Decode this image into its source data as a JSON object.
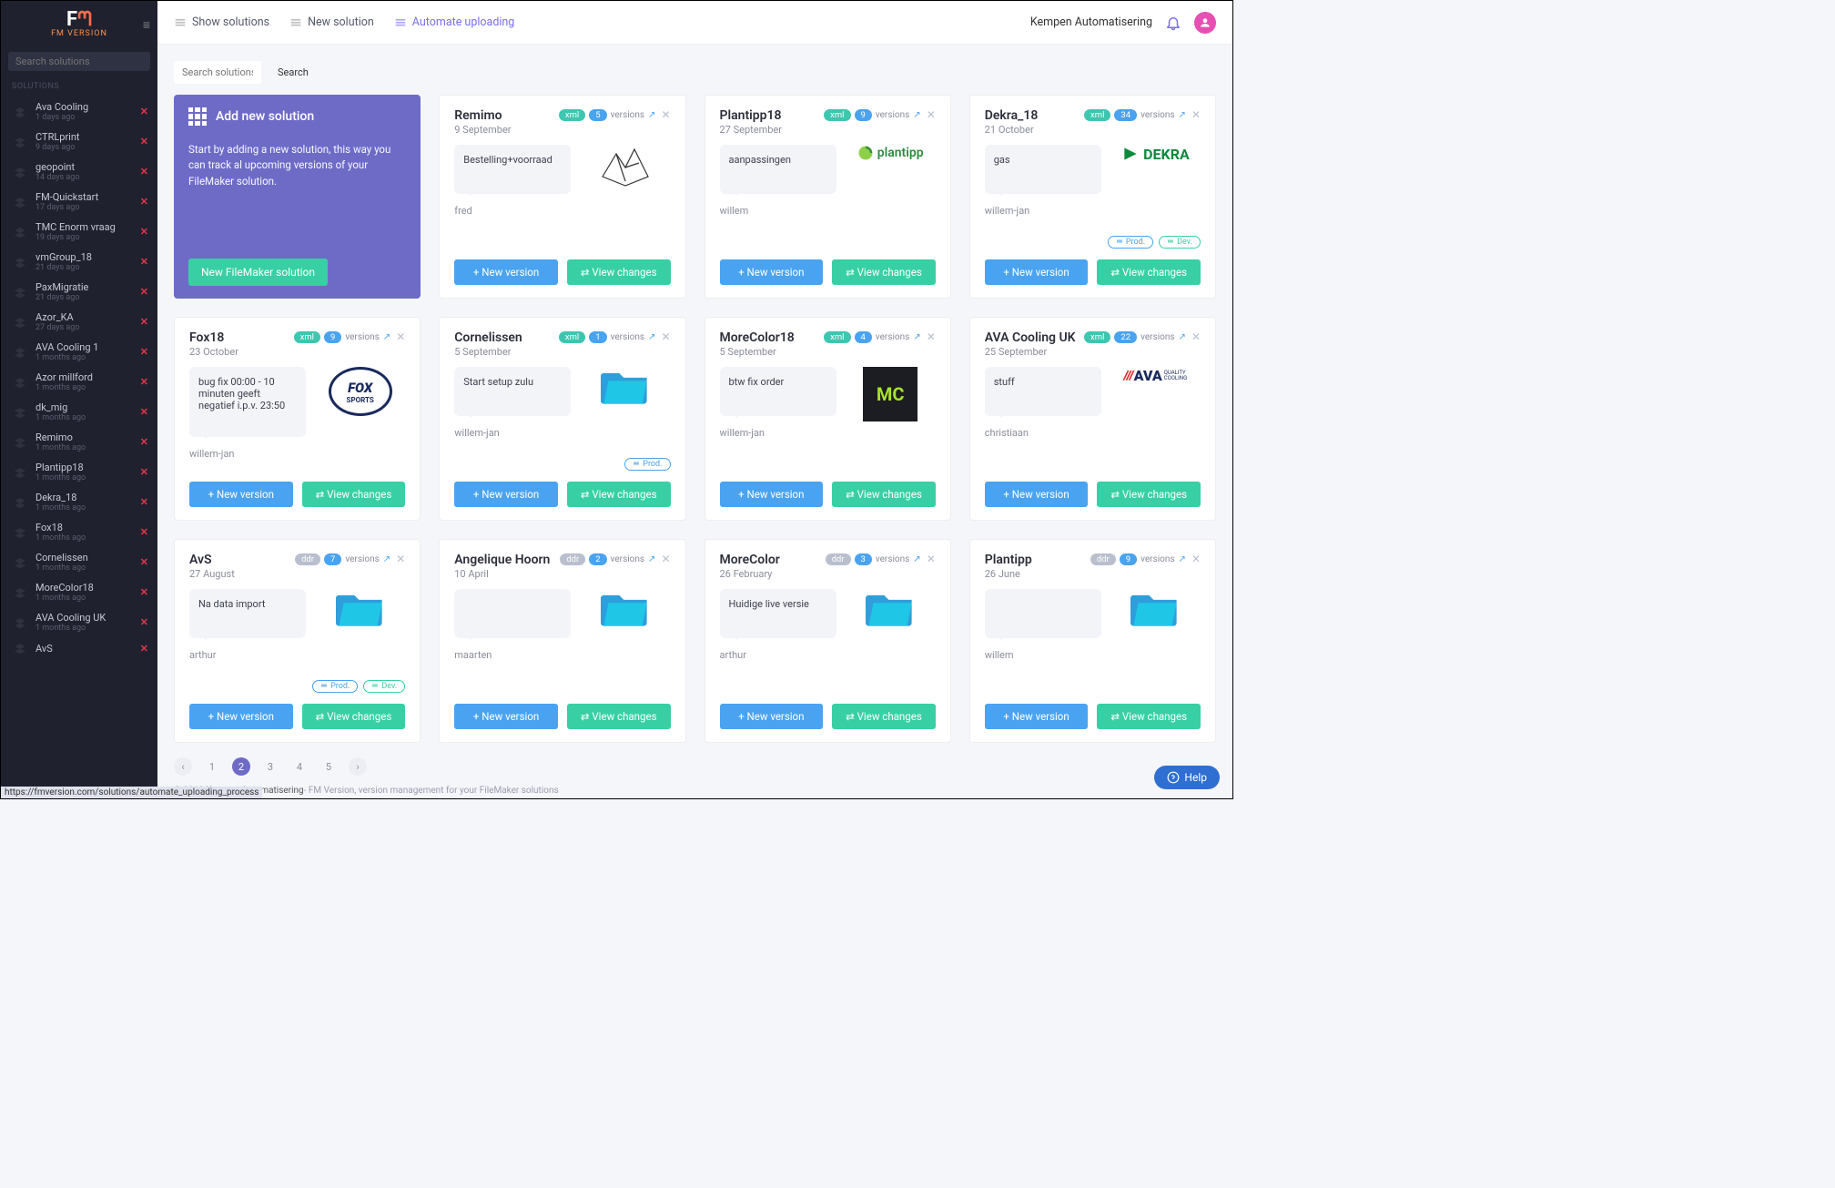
{
  "brand": {
    "name": "FM VERSION"
  },
  "sidebar": {
    "search_placeholder": "Search solutions",
    "section": "SOLUTIONS",
    "items": [
      {
        "name": "Ava Cooling",
        "age": "1 days ago"
      },
      {
        "name": "CTRLprint",
        "age": "9 days ago"
      },
      {
        "name": "geopoint",
        "age": "14 days ago"
      },
      {
        "name": "FM-Quickstart",
        "age": "17 days ago"
      },
      {
        "name": "TMC Enorm vraag",
        "age": "19 days ago"
      },
      {
        "name": "vmGroup_18",
        "age": "21 days ago"
      },
      {
        "name": "PaxMigratie",
        "age": "21 days ago"
      },
      {
        "name": "Azor_KA",
        "age": "27 days ago"
      },
      {
        "name": "AVA Cooling 1",
        "age": "1 months ago"
      },
      {
        "name": "Azor millford",
        "age": "1 months ago"
      },
      {
        "name": "dk_mig",
        "age": "1 months ago"
      },
      {
        "name": "Remimo",
        "age": "1 months ago"
      },
      {
        "name": "Plantipp18",
        "age": "1 months ago"
      },
      {
        "name": "Dekra_18",
        "age": "1 months ago"
      },
      {
        "name": "Fox18",
        "age": "1 months ago"
      },
      {
        "name": "Cornelissen",
        "age": "1 months ago"
      },
      {
        "name": "MoreColor18",
        "age": "1 months ago"
      },
      {
        "name": "AVA Cooling UK",
        "age": "1 months ago"
      },
      {
        "name": "AvS",
        "age": ""
      }
    ]
  },
  "topbar": {
    "links": {
      "show": "Show solutions",
      "new": "New solution",
      "auto": "Automate uploading"
    },
    "org": "Kempen Automatisering"
  },
  "search": {
    "placeholder": "Search solutions",
    "button": "Search"
  },
  "hero": {
    "title": "Add new solution",
    "desc": "Start by adding a new solution, this way you can track al upcoming versions of your FileMaker solution.",
    "button": "New FileMaker solution"
  },
  "labels": {
    "versions": "versions",
    "new_version": "New version",
    "view_changes": "View changes",
    "prod": "Prod.",
    "dev": "Dev.",
    "help": "Help"
  },
  "cards": [
    {
      "title": "Remimo",
      "date": "9 September",
      "type": "xml",
      "count": "5",
      "note": "Bestelling+voorraad",
      "author": "fred",
      "logo": "origami",
      "tags": []
    },
    {
      "title": "Plantipp18",
      "date": "27 September",
      "type": "xml",
      "count": "9",
      "note": "aanpassingen",
      "author": "willem",
      "logo": "plantipp",
      "tags": []
    },
    {
      "title": "Dekra_18",
      "date": "21 October",
      "type": "xml",
      "count": "34",
      "note": "gas",
      "author": "willem-jan",
      "logo": "dekra",
      "tags": [
        "prod",
        "dev"
      ]
    },
    {
      "title": "Fox18",
      "date": "23 October",
      "type": "xml",
      "count": "9",
      "note": "bug fix 00:00 - 10 minuten geeft negatief i.p.v. 23:50",
      "author": "willem-jan",
      "logo": "fox",
      "tags": []
    },
    {
      "title": "Cornelissen",
      "date": "5 September",
      "type": "xml",
      "count": "1",
      "note": "Start setup zulu",
      "author": "willem-jan",
      "logo": "folder",
      "tags": [
        "prod"
      ]
    },
    {
      "title": "MoreColor18",
      "date": "5 September",
      "type": "xml",
      "count": "4",
      "note": "btw fix order",
      "author": "willem-jan",
      "logo": "mc",
      "tags": []
    },
    {
      "title": "AVA Cooling UK",
      "date": "25 September",
      "type": "xml",
      "count": "22",
      "note": "stuff",
      "author": "christiaan",
      "logo": "ava",
      "tags": []
    },
    {
      "title": "AvS",
      "date": "27 August",
      "type": "ddr",
      "count": "7",
      "note": "Na data import",
      "author": "arthur",
      "logo": "folder",
      "tags": [
        "prod",
        "dev"
      ]
    },
    {
      "title": "Angelique Hoorn",
      "date": "10 April",
      "type": "ddr",
      "count": "2",
      "note": "",
      "author": "maarten",
      "logo": "folder",
      "tags": []
    },
    {
      "title": "MoreColor",
      "date": "26 February",
      "type": "ddr",
      "count": "3",
      "note": "Huidige live versie",
      "author": "arthur",
      "logo": "folder",
      "tags": []
    },
    {
      "title": "Plantipp",
      "date": "26 June",
      "type": "ddr",
      "count": "9",
      "note": "",
      "author": "willem",
      "logo": "folder",
      "tags": []
    }
  ],
  "pager": {
    "pages": [
      "1",
      "2",
      "3",
      "4",
      "5"
    ],
    "active": "2"
  },
  "footer": {
    "org": "Kempen Automatisering",
    "rest": " - FM Version, version management for your FileMaker solutions"
  },
  "status_url": "https://fmversion.com/solutions/automate_uploading_process"
}
